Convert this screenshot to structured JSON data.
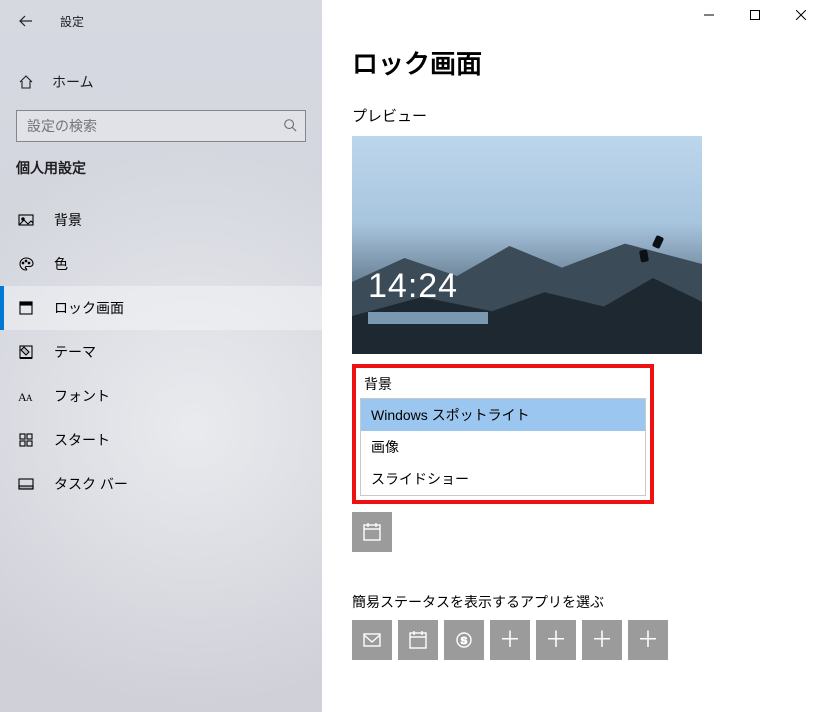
{
  "window": {
    "title": "設定"
  },
  "sidebar": {
    "home_label": "ホーム",
    "search_placeholder": "設定の検索",
    "section_label": "個人用設定",
    "items": [
      {
        "label": "背景",
        "icon": "picture-icon"
      },
      {
        "label": "色",
        "icon": "palette-icon"
      },
      {
        "label": "ロック画面",
        "icon": "lock-screen-icon",
        "selected": true
      },
      {
        "label": "テーマ",
        "icon": "theme-icon"
      },
      {
        "label": "フォント",
        "icon": "font-icon"
      },
      {
        "label": "スタート",
        "icon": "start-icon"
      },
      {
        "label": "タスク バー",
        "icon": "taskbar-icon"
      }
    ]
  },
  "main": {
    "page_title": "ロック画面",
    "preview_label": "プレビュー",
    "preview_time": "14:24",
    "bg_section_label": "背景",
    "bg_options": [
      {
        "label": "Windows スポットライト",
        "selected": true
      },
      {
        "label": "画像"
      },
      {
        "label": "スライドショー"
      }
    ],
    "quick_status_label": "簡易ステータスを表示するアプリを選ぶ",
    "quick_tiles": [
      "mail-icon",
      "calendar-icon",
      "skype-icon",
      "plus",
      "plus",
      "plus",
      "plus"
    ],
    "detailed_tile": "calendar-icon"
  }
}
